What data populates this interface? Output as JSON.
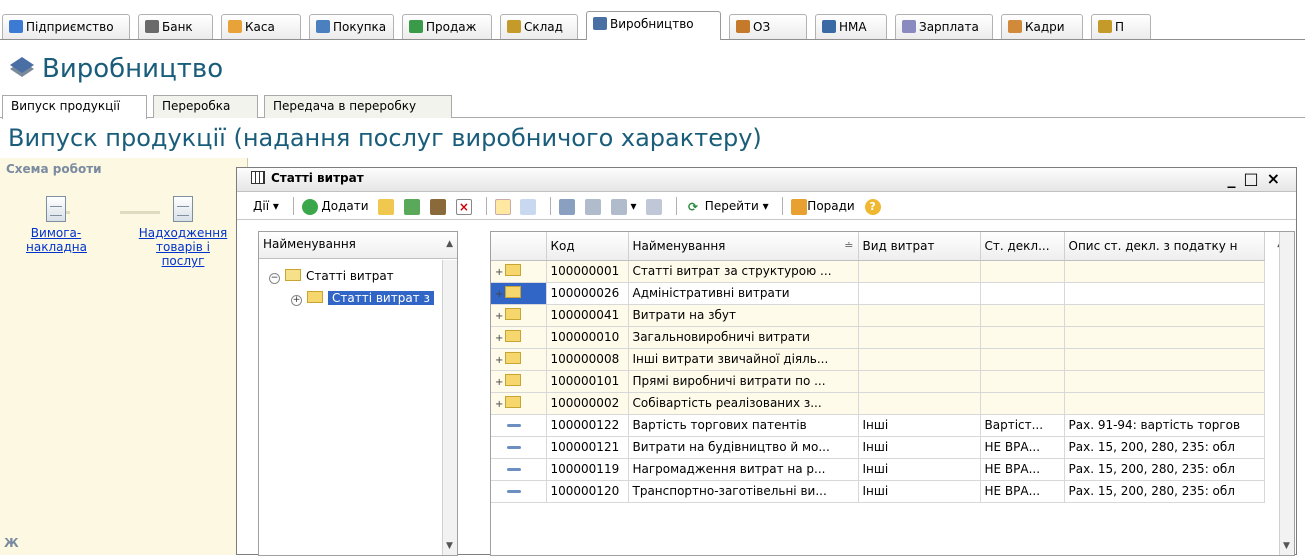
{
  "app": {
    "tabs": [
      {
        "label": "Підприємство",
        "icon": "enterprise-icon",
        "color": "#3b7bd4"
      },
      {
        "label": "Банк",
        "icon": "bank-icon",
        "color": "#6a6a6a"
      },
      {
        "label": "Каса",
        "icon": "cash-icon",
        "color": "#e8a23a"
      },
      {
        "label": "Покупка",
        "icon": "purchase-icon",
        "color": "#4a7fc0"
      },
      {
        "label": "Продаж",
        "icon": "sale-icon",
        "color": "#3a9a4a"
      },
      {
        "label": "Склад",
        "icon": "warehouse-icon",
        "color": "#c49a2a"
      },
      {
        "label": "Виробництво",
        "icon": "production-icon",
        "color": "#4a6fa5"
      },
      {
        "label": "ОЗ",
        "icon": "fixed-assets-icon",
        "color": "#c47a2a"
      },
      {
        "label": "НМА",
        "icon": "intangible-icon",
        "color": "#3a6aa5"
      },
      {
        "label": "Зарплата",
        "icon": "salary-icon",
        "color": "#8a8ac0"
      },
      {
        "label": "Кадри",
        "icon": "personnel-icon",
        "color": "#d08a3a"
      },
      {
        "label": "П",
        "icon": "more-icon",
        "color": "#c49a2a"
      }
    ],
    "active_tab": "Виробництво"
  },
  "page": {
    "title": "Виробництво",
    "subtabs": [
      "Випуск продукції",
      "Переробка",
      "Передача в переробку"
    ],
    "subtitle": "Випуск продукції (надання послуг виробничого характеру)"
  },
  "scheme": {
    "title": "Схема роботи",
    "items": [
      {
        "label": "Вимога-накладна",
        "lines": [
          "Вимога-",
          "накладна"
        ]
      },
      {
        "label": "Надходження товарів і послуг",
        "lines": [
          "Надходження",
          "товарів і",
          "послуг"
        ]
      }
    ],
    "bottom_label": "Ж"
  },
  "window": {
    "title": "Статті витрат",
    "controls": [
      "_",
      "□",
      "×"
    ],
    "toolbar": {
      "actions": "Дії",
      "add": "Додати",
      "goto": "Перейти",
      "hints": "Поради"
    },
    "tree": {
      "header": "Найменування",
      "root": "Статті витрат",
      "child": "Статті витрат з"
    },
    "table": {
      "columns": [
        "",
        "Код",
        "Найменування",
        "Вид витрат",
        "Ст. декл...",
        "Опис ст. декл. з податку н"
      ],
      "rows": [
        {
          "kind": "folder",
          "code": "100000001",
          "name": "Статті витрат за структурою ...",
          "type": "",
          "decl": "",
          "desc": ""
        },
        {
          "kind": "folder",
          "code": "100000026",
          "name": "Адміністративні витрати",
          "type": "",
          "decl": "",
          "desc": "",
          "selected": true
        },
        {
          "kind": "folder",
          "code": "100000041",
          "name": "Витрати на збут",
          "type": "",
          "decl": "",
          "desc": ""
        },
        {
          "kind": "folder",
          "code": "100000010",
          "name": "Загальновиробничі витрати",
          "type": "",
          "decl": "",
          "desc": ""
        },
        {
          "kind": "folder",
          "code": "100000008",
          "name": "Інші витрати звичайної діяль...",
          "type": "",
          "decl": "",
          "desc": ""
        },
        {
          "kind": "folder",
          "code": "100000101",
          "name": "Прямі виробничі витрати по ...",
          "type": "",
          "decl": "",
          "desc": ""
        },
        {
          "kind": "folder",
          "code": "100000002",
          "name": "Собівартість реалізованих з...",
          "type": "",
          "decl": "",
          "desc": ""
        },
        {
          "kind": "item",
          "code": "100000122",
          "name": "Вартість торгових патентів",
          "type": "Інші",
          "decl": "Вартіст...",
          "desc": "Рах. 91-94: вартість торгов"
        },
        {
          "kind": "item",
          "code": "100000121",
          "name": "Витрати на будівництво й мо...",
          "type": "Інші",
          "decl": "НЕ ВРА...",
          "desc": "Рах. 15, 200, 280, 235: обл"
        },
        {
          "kind": "item",
          "code": "100000119",
          "name": "Нагромадження витрат на р...",
          "type": "Інші",
          "decl": "НЕ ВРА...",
          "desc": "Рах. 15, 200, 280, 235: обл"
        },
        {
          "kind": "item",
          "code": "100000120",
          "name": "Транспортно-заготівельні ви...",
          "type": "Інші",
          "decl": "НЕ ВРА...",
          "desc": "Рах. 15, 200, 280, 235: обл"
        }
      ]
    }
  }
}
